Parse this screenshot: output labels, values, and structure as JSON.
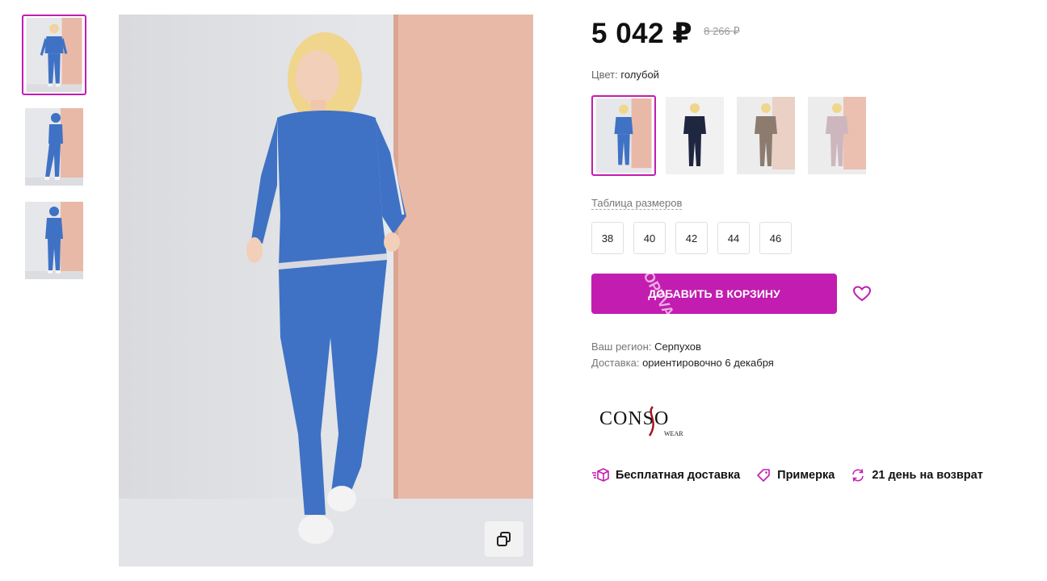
{
  "product": {
    "price": "5 042 ₽",
    "old_price": "8 266 ₽"
  },
  "color": {
    "label": "Цвет:",
    "value": "голубой",
    "swatches": [
      {
        "name": "blue",
        "top": "#3f72c4",
        "bottom": "#3f72c4",
        "bg": "#e9b9a8"
      },
      {
        "name": "navy",
        "top": "#1f2640",
        "bottom": "#1f2640",
        "bg": "#f1f1f1"
      },
      {
        "name": "taupe",
        "top": "#8d7b70",
        "bottom": "#8d7b70",
        "bg": "#ead0c5"
      },
      {
        "name": "lilac",
        "top": "#cdb6bd",
        "bottom": "#cdb6bd",
        "bg": "#ebc0b0"
      }
    ]
  },
  "sizes": {
    "table_link": "Таблица размеров",
    "options": [
      "38",
      "40",
      "42",
      "44",
      "46"
    ]
  },
  "cart": {
    "button_label": "Добавить в корзину",
    "watermark": "optvar"
  },
  "delivery": {
    "region_label": "Ваш регион:",
    "region_value": "Серпухов",
    "delivery_label": "Доставка:",
    "delivery_value": "ориентировочно 6 декабря"
  },
  "brand": {
    "logo_text": "CONSO",
    "logo_sub": "WEAR"
  },
  "perks": [
    {
      "icon": "delivery-box-icon",
      "label": "Бесплатная доставка"
    },
    {
      "icon": "tag-icon",
      "label": "Примерка"
    },
    {
      "icon": "return-arrows-icon",
      "label": "21 день на возврат"
    }
  ],
  "colors": {
    "accent": "#c21db0",
    "outfit": "#3f72c4",
    "backdrop_pink": "#e9b9a8",
    "backdrop_grey": "#e6e7ea"
  }
}
